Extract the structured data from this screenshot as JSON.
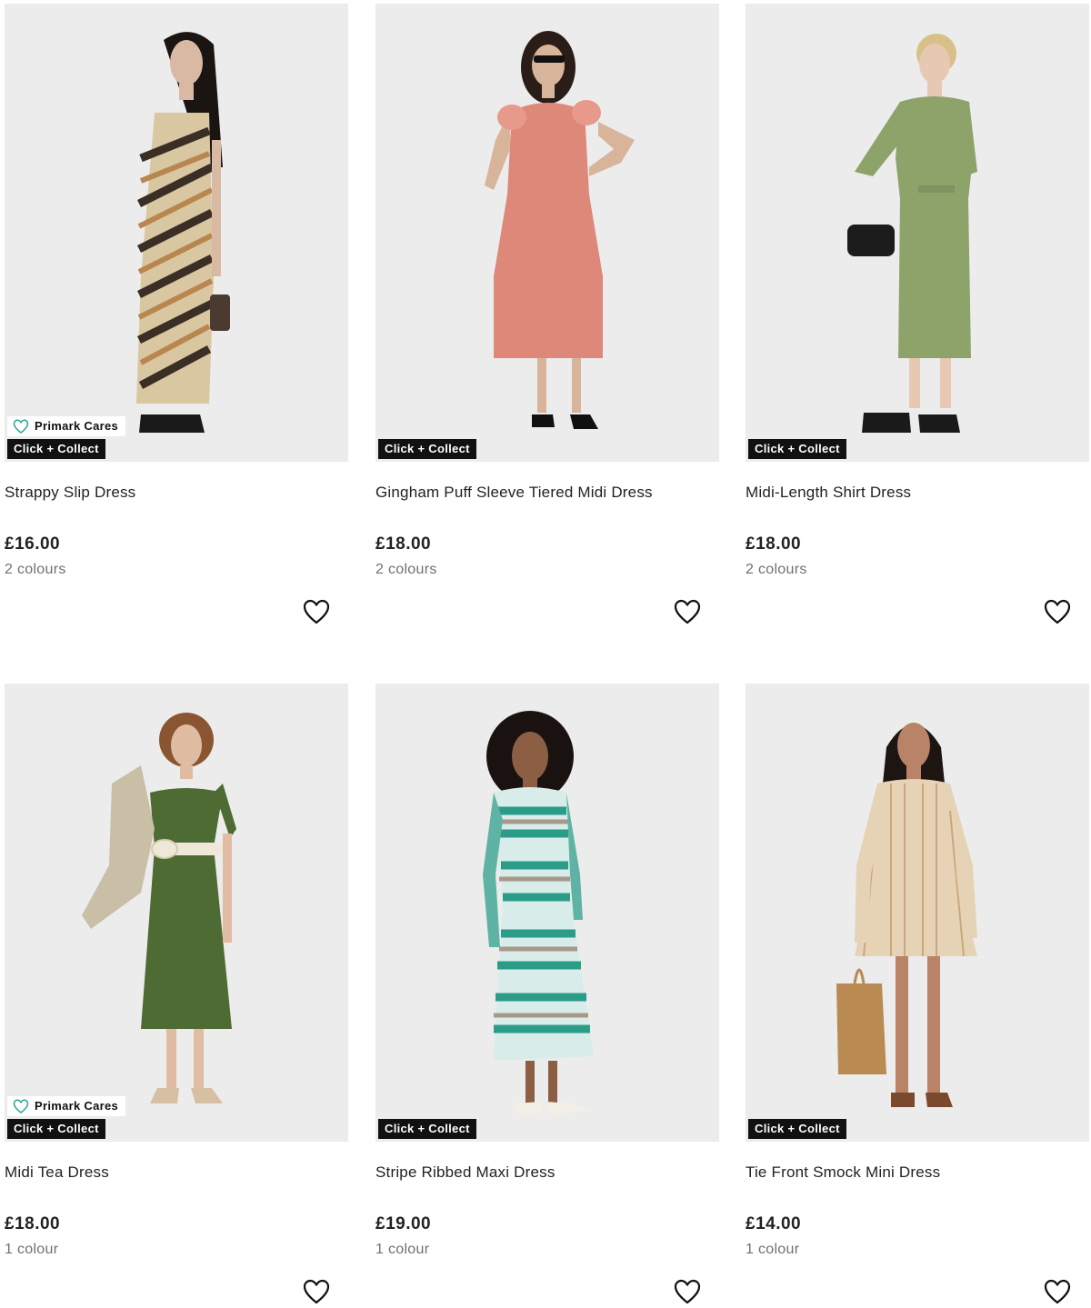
{
  "products": [
    {
      "name": "Gingham Puff Sleeve Tiered Midi Dress",
      "price": "£18.00",
      "colours": "2 colours",
      "badge": "Click + Collect",
      "cares": null,
      "dress_color": "#dd8878",
      "skin_color": "#d8b49a",
      "hair_color": "#2a1d17"
    },
    {
      "name": "Midi-Length Shirt Dress",
      "price": "£18.00",
      "colours": "2 colours",
      "badge": "Click + Collect",
      "cares": null,
      "dress_color": "#8ea36a",
      "skin_color": "#e7c8b3",
      "hair_color": "#d9c089"
    },
    {
      "name": "Strappy Slip Dress",
      "price": "£16.00",
      "colours": "2 colours",
      "badge": "Click + Collect",
      "cares": "Primark Cares",
      "dress_color": "#d9c7a2",
      "skin_color": "#d9b9a4",
      "hair_color": "#1a1412"
    },
    {
      "name": "Stripe Ribbed Maxi Dress",
      "price": "£19.00",
      "colours": "1 colour",
      "badge": "Click + Collect",
      "cares": null,
      "dress_color": "#5fb3a5",
      "skin_color": "#8c5f45",
      "hair_color": "#1a1210"
    },
    {
      "name": "Tie Front Smock Mini Dress",
      "price": "£14.00",
      "colours": "1 colour",
      "badge": "Click + Collect",
      "cares": null,
      "dress_color": "#e6d3b5",
      "skin_color": "#b88366",
      "hair_color": "#1d1512"
    },
    {
      "name": "Midi Tea Dress",
      "price": "£18.00",
      "colours": "1 colour",
      "badge": "Click + Collect",
      "cares": "Primark Cares",
      "dress_color": "#4f6b34",
      "skin_color": "#e0bca3",
      "hair_color": "#8a5632"
    }
  ],
  "icons": {
    "favourite": "heart-outline-icon",
    "cares": "heart-outline-icon"
  },
  "colors": {
    "badge_bg": "#111111",
    "price": "#222222",
    "muted": "#707070",
    "cares_accent": "#2aa39a"
  }
}
